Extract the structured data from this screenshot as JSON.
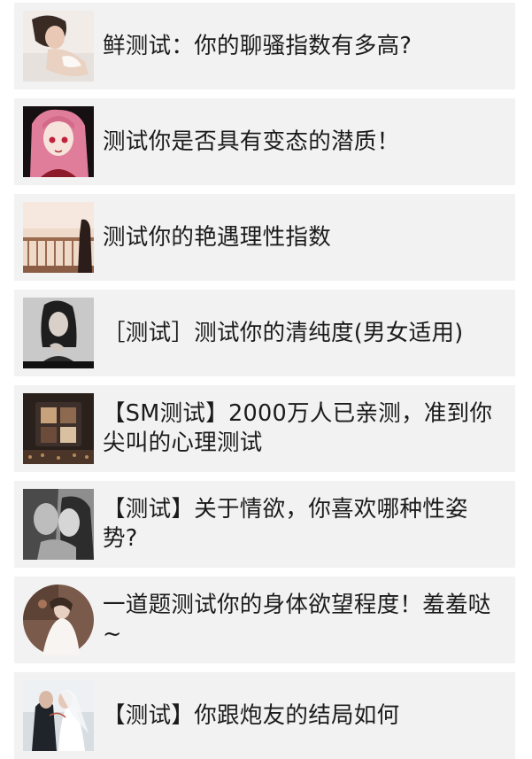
{
  "feed": {
    "items": [
      {
        "title": "鲜测试：你的聊骚指数有多高?",
        "thumbnail": "woman-lying-photo"
      },
      {
        "title": "测试你是否具有变态的潜质！",
        "thumbnail": "anime-girl-image"
      },
      {
        "title": "测试你的艳遇理性指数",
        "thumbnail": "balcony-photo"
      },
      {
        "title": "［测试］测试你的清纯度(男女适用)",
        "thumbnail": "woman-portrait-bw-photo"
      },
      {
        "title": "【SM测试】2000万人已亲测，准到你尖叫的心理测试",
        "thumbnail": "eyeshadow-palette-photo"
      },
      {
        "title": "【测试】关于情欲，你喜欢哪种性姿势?",
        "thumbnail": "couple-bw-photo"
      },
      {
        "title": "一道题测试你的身体欲望程度！羞羞哒~",
        "thumbnail": "bride-round-photo"
      },
      {
        "title": "【测试】你跟炮友的结局如何",
        "thumbnail": "wedding-kiss-photo"
      }
    ]
  }
}
